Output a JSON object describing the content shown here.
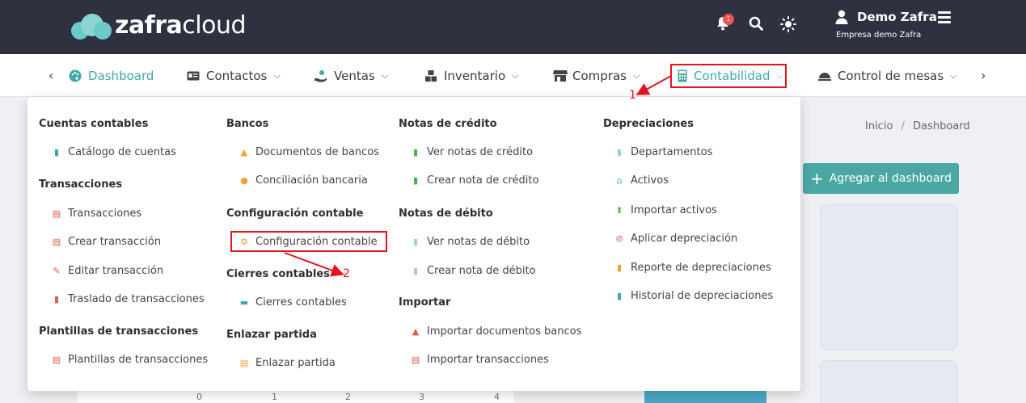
{
  "header": {
    "logo": {
      "bold": "zafra",
      "light": "cloud"
    },
    "notification_count": "1",
    "user_name": "Demo Zafra",
    "company": "Empresa demo Zafra"
  },
  "nav": {
    "prev_arrow": "‹",
    "next_arrow": "›",
    "items": [
      {
        "label": "Dashboard",
        "icon": "palette-icon"
      },
      {
        "label": "Contactos",
        "icon": "id-card-icon"
      },
      {
        "label": "Ventas",
        "icon": "hand-coin-icon"
      },
      {
        "label": "Inventario",
        "icon": "boxes-icon"
      },
      {
        "label": "Compras",
        "icon": "store-icon"
      },
      {
        "label": "Contabilidad",
        "icon": "calculator-icon"
      },
      {
        "label": "Control de mesas",
        "icon": "cloche-icon"
      }
    ]
  },
  "background": {
    "breadcrumb_home": "Inicio",
    "breadcrumb_sep": "/",
    "breadcrumb_current": "Dashboard",
    "add_button": "Agregar al dashboard",
    "axis_ticks": [
      "0",
      "1",
      "2",
      "3",
      "4"
    ]
  },
  "mega_menu": {
    "col1": {
      "s1": "Cuentas contables",
      "l1": "Catálogo de cuentas",
      "s2": "Transacciones",
      "l2": "Transacciones",
      "l3": "Crear transacción",
      "l4": "Editar transacción",
      "l5": "Traslado de transacciones",
      "s3": "Plantillas de transacciones",
      "l6": "Plantillas de transacciones"
    },
    "col2": {
      "s1": "Bancos",
      "l1": "Documentos de bancos",
      "l2": "Conciliación bancaria",
      "s2": "Configuración contable",
      "l3": "Configuración contable",
      "s3": "Cierres contables",
      "l4": "Cierres contables",
      "s4": "Enlazar partida",
      "l5": "Enlazar partida"
    },
    "col3": {
      "s1": "Notas de crédito",
      "l1": "Ver notas de crédito",
      "l2": "Crear nota de crédito",
      "s2": "Notas de débito",
      "l3": "Ver notas de débito",
      "l4": "Crear nota de débito",
      "s3": "Importar",
      "l5": "Importar documentos bancos",
      "l6": "Importar transacciones"
    },
    "col4": {
      "s1": "Depreciaciones",
      "l1": "Departamentos",
      "l2": "Activos",
      "l3": "Importar activos",
      "l4": "Aplicar depreciación",
      "l5": "Reporte de depreciaciones",
      "l6": "Historial de depreciaciones"
    }
  },
  "annotations": {
    "a1": "1",
    "a2": "2"
  },
  "colors": {
    "topbar": "#2d3140",
    "accent": "#3fa8a8",
    "annotation": "#e8121c"
  }
}
